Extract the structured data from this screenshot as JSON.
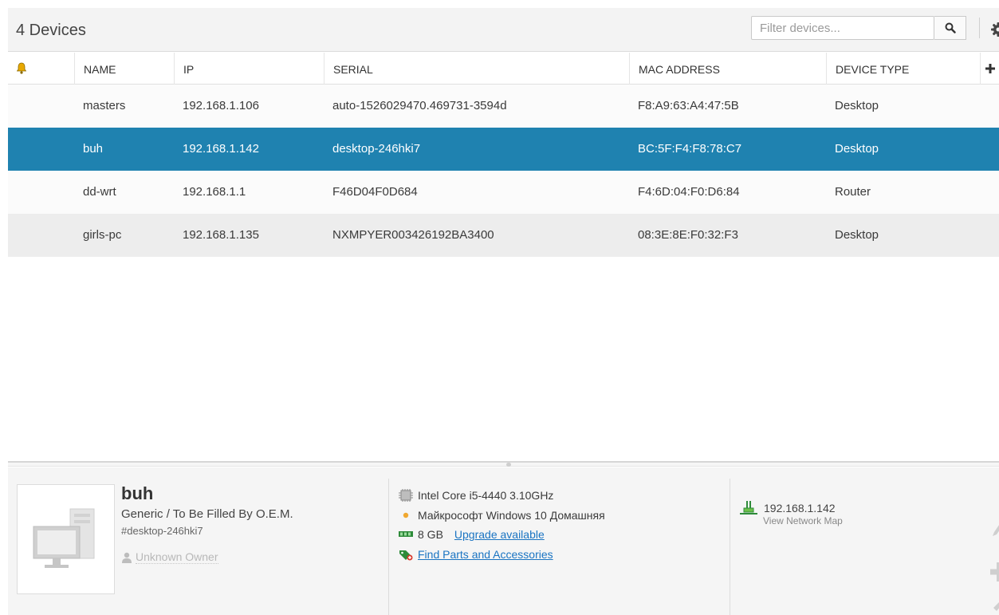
{
  "header": {
    "title": "4 Devices",
    "filter_placeholder": "Filter devices..."
  },
  "table": {
    "columns": [
      "NAME",
      "IP",
      "SERIAL",
      "MAC ADDRESS",
      "DEVICE TYPE"
    ],
    "rows": [
      {
        "name": "masters",
        "ip": "192.168.1.106",
        "serial": "auto-1526029470.469731-3594d",
        "mac": "F8:A9:63:A4:47:5B",
        "type": "Desktop"
      },
      {
        "name": "buh",
        "ip": "192.168.1.142",
        "serial": "desktop-246hki7",
        "mac": "BC:5F:F4:F8:78:C7",
        "type": "Desktop"
      },
      {
        "name": "dd-wrt",
        "ip": "192.168.1.1",
        "serial": "F46D04F0D684",
        "mac": "F4:6D:04:F0:D6:84",
        "type": "Router"
      },
      {
        "name": "girls-pc",
        "ip": "192.168.1.135",
        "serial": "NXMPYER003426192BA3400",
        "mac": "08:3E:8E:F0:32:F3",
        "type": "Desktop"
      }
    ],
    "selected_index": 1
  },
  "details": {
    "name": "buh",
    "model": "Generic / To Be Filled By O.E.M.",
    "hostname": "#desktop-246hki7",
    "owner": "Unknown Owner",
    "cpu": "Intel Core i5-4440 3.10GHz",
    "os": "Майкрософт Windows 10 Домашняя",
    "ram": "8 GB",
    "upgrade_link": "Upgrade available",
    "parts_link": "Find Parts and Accessories",
    "ip": "192.168.1.142",
    "network_map_link": "View Network Map"
  },
  "colors": {
    "selected_row": "#1f82b0",
    "link": "#1a74c2",
    "alert_bell": "#e8a800"
  },
  "icons": [
    "search-icon",
    "gear-icon",
    "bell-icon",
    "add-column-icon",
    "desktop-icon",
    "user-icon",
    "cpu-icon",
    "os-status-icon",
    "ram-icon",
    "parts-icon",
    "network-icon",
    "edit-icon",
    "add-icon",
    "tools-icon"
  ]
}
